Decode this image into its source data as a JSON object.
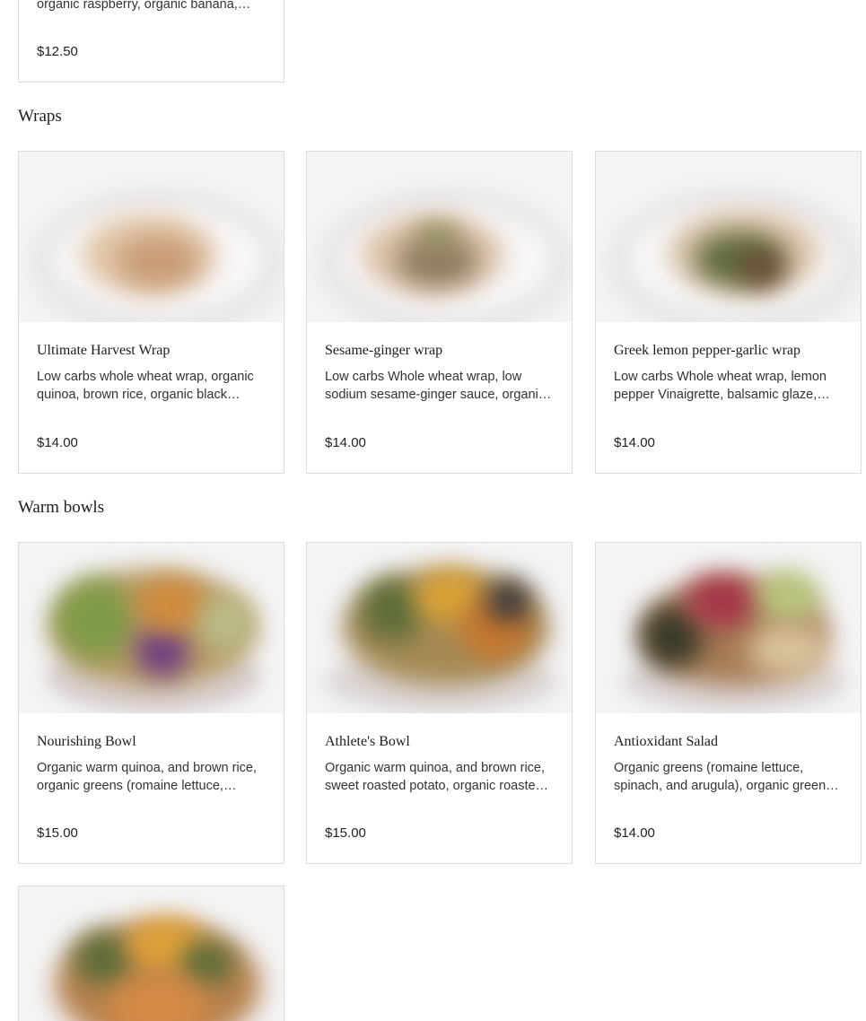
{
  "top_card": {
    "desc": "organic raspberry, organic banana,…",
    "price": "$12.50"
  },
  "sections": [
    {
      "title": "Wraps",
      "items": [
        {
          "name": "Ultimate Harvest Wrap",
          "desc": "Low carbs whole wheat wrap, organic quinoa, brown rice, organic black…",
          "price": "$14.00",
          "image": "wrap-photo"
        },
        {
          "name": "Sesame-ginger wrap",
          "desc": "Low carbs Whole wheat wrap, low sodium sesame-ginger sauce, organi…",
          "price": "$14.00",
          "image": "wrap-photo"
        },
        {
          "name": "Greek lemon pepper-garlic wrap",
          "desc": "Low carbs Whole wheat wrap, lemon pepper Vinaigrette, balsamic glaze,…",
          "price": "$14.00",
          "image": "wrap-photo"
        }
      ]
    },
    {
      "title": "Warm bowls",
      "items": [
        {
          "name": "Nourishing Bowl",
          "desc": "Organic warm quinoa, and brown rice, organic greens (romaine lettuce,…",
          "price": "$15.00",
          "image": "bowl-photo"
        },
        {
          "name": "Athlete's Bowl",
          "desc": "Organic warm quinoa, and brown rice, sweet roasted potato, organic roaste…",
          "price": "$15.00",
          "image": "bowl-photo"
        },
        {
          "name": "Antioxidant Salad",
          "desc": "Organic greens (romaine lettuce, spinach, and arugula), organic green…",
          "price": "$14.00",
          "image": "bowl-photo"
        }
      ]
    }
  ],
  "partial_card": {
    "image": "bowl-photo"
  }
}
